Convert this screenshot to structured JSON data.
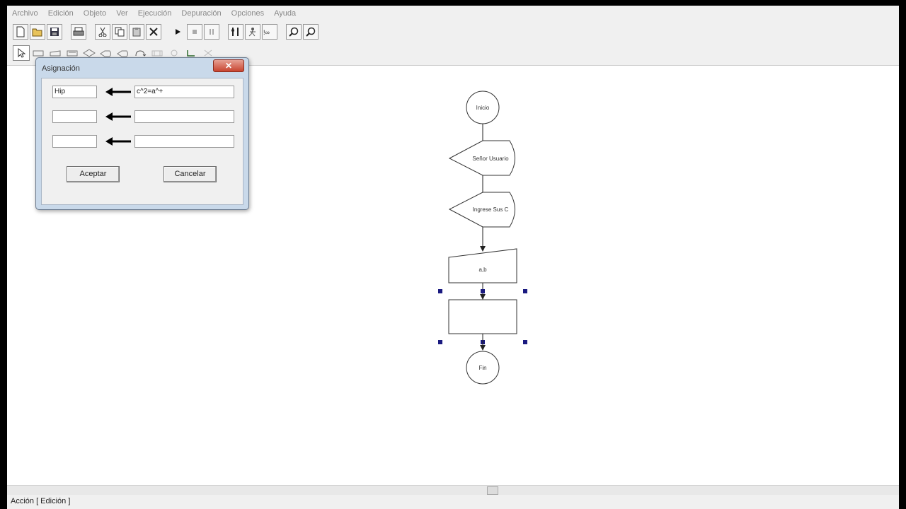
{
  "menu": [
    "Archivo",
    "Edición",
    "Objeto",
    "Ver",
    "Ejecución",
    "Depuración",
    "Opciones",
    "Ayuda"
  ],
  "toolbar1": [
    {
      "icon": "new-document-icon"
    },
    {
      "icon": "open-folder-icon"
    },
    {
      "icon": "save-disk-icon"
    },
    {
      "icon": "print-icon"
    },
    {
      "icon": "cut-scissors-icon"
    },
    {
      "icon": "copy-icon"
    },
    {
      "icon": "paste-icon"
    },
    {
      "icon": "delete-x-icon"
    },
    {
      "icon": "run-play-icon"
    },
    {
      "icon": "stop-icon"
    },
    {
      "icon": "pause-icon"
    },
    {
      "icon": "step-icon"
    },
    {
      "icon": "step-over-icon"
    },
    {
      "icon": "watch-variables-icon"
    },
    {
      "icon": "zoom-in-icon"
    },
    {
      "icon": "zoom-out-icon"
    }
  ],
  "toolbar2": [
    {
      "icon": "select-pointer-icon"
    },
    {
      "icon": "assignment-shape-icon"
    },
    {
      "icon": "input-shape-icon"
    },
    {
      "icon": "output-shape-icon"
    },
    {
      "icon": "decision-shape-icon"
    },
    {
      "icon": "screen-output-icon"
    },
    {
      "icon": "print-output-icon"
    },
    {
      "icon": "loop-icon"
    },
    {
      "icon": "subroutine-icon"
    },
    {
      "icon": "connector-icon"
    },
    {
      "icon": "insert-icon"
    },
    {
      "icon": "remove-icon"
    }
  ],
  "dialog": {
    "title": "Asignación",
    "close_label": "✕",
    "rows": [
      {
        "variable": "Hip",
        "expression": "c^2=a^+"
      },
      {
        "variable": "",
        "expression": ""
      },
      {
        "variable": "",
        "expression": ""
      }
    ],
    "accept_label": "Aceptar",
    "cancel_label": "Cancelar"
  },
  "flowchart": {
    "start_label": "Inicio",
    "output1_label": "Señor Usuario",
    "output2_label": "Ingrese Sus C",
    "input_label": "a,b",
    "assignment_label": "",
    "end_label": "Fin"
  },
  "status": {
    "mode": "Acción [ Edición ]",
    "corner": "⌄"
  }
}
